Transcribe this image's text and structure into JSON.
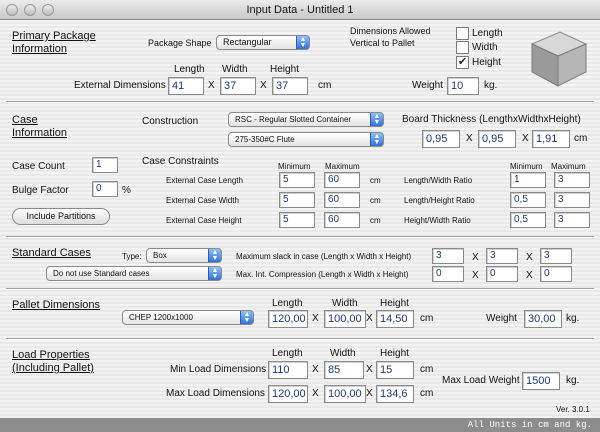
{
  "window": {
    "title": "Input Data - Untitled 1"
  },
  "primary": {
    "title_line1": "Primary Package",
    "title_line2": "Information",
    "shape_label": "Package Shape",
    "shape_value": "Rectangular",
    "dims_allowed_line1": "Dimensions Allowed",
    "dims_allowed_line2": "Vertical to Pallet",
    "vert_length": {
      "label": "Length",
      "checked": false
    },
    "vert_width": {
      "label": "Width",
      "checked": false
    },
    "vert_height": {
      "label": "Height",
      "checked": true
    },
    "hdr_length": "Length",
    "hdr_width": "Width",
    "hdr_height": "Height",
    "ext_dims_label": "External Dimensions",
    "length": "41",
    "width": "37",
    "height": "37",
    "unit_cm": "cm",
    "weight_label": "Weight",
    "weight": "10",
    "weight_unit": "kg."
  },
  "case": {
    "title_line1": "Case",
    "title_line2": "Information",
    "construction_label": "Construction",
    "construction_value": "RSC - Regular Slotted Container",
    "flute_value": "275-350#C Flute",
    "board_label": "Board Thickness (LengthxWidthxHeight)",
    "board_l": "0,95",
    "board_w": "0,95",
    "board_h": "1,91",
    "board_unit": "cm",
    "count_label": "Case Count",
    "count": "1",
    "bulge_label": "Bulge Factor",
    "bulge": "0",
    "bulge_unit": "%",
    "partitions_button": "Include Partitions",
    "constraints_label": "Case Constraints",
    "min_hdr": "Minimum",
    "max_hdr": "Maximum",
    "rows": [
      {
        "label": "External Case Length",
        "min": "5",
        "max": "60",
        "unit": "cm",
        "ratio_label": "Length/Width Ratio",
        "rmin": "1",
        "rmax": "3"
      },
      {
        "label": "External Case Width",
        "min": "5",
        "max": "60",
        "unit": "cm",
        "ratio_label": "Length/Height Ratio",
        "rmin": "0,5",
        "rmax": "3"
      },
      {
        "label": "External Case Height",
        "min": "5",
        "max": "60",
        "unit": "cm",
        "ratio_label": "Height/Width Ratio",
        "rmin": "0,5",
        "rmax": "3"
      }
    ]
  },
  "standard": {
    "title": "Standard Cases",
    "type_label": "Type:",
    "type_value": "Box",
    "std_value": "Do not use Standard cases",
    "slack_label": "Maximum slack in case  (Length x Width x Height)",
    "slack_l": "3",
    "slack_w": "3",
    "slack_h": "3",
    "comp_label": "Max. Int. Compression (Length x Width x Height)",
    "comp_l": "0",
    "comp_w": "0",
    "comp_h": "0",
    "x": "X"
  },
  "pallet": {
    "title": "Pallet Dimensions",
    "type_value": "CHEP 1200x1000",
    "hdr_length": "Length",
    "hdr_width": "Width",
    "hdr_height": "Height",
    "length": "120,00",
    "width": "100,00",
    "height": "14,50",
    "unit": "cm",
    "weight_label": "Weight",
    "weight": "30,00",
    "weight_unit": "kg."
  },
  "load": {
    "title_line1": "Load Properties",
    "title_line2": "(Including Pallet)",
    "hdr_length": "Length",
    "hdr_width": "Width",
    "hdr_height": "Height",
    "min_label": "Min Load Dimensions",
    "min_l": "110",
    "min_w": "85",
    "min_h": "15",
    "max_label": "Max Load Dimensions",
    "max_l": "120,00",
    "max_w": "100,00",
    "max_h": "134,6",
    "unit": "cm",
    "max_weight_label": "Max Load Weight",
    "max_weight": "1500",
    "max_weight_unit": "kg."
  },
  "footer": {
    "version": "Ver. 3.0.1",
    "status": "All Units in cm and kg."
  }
}
